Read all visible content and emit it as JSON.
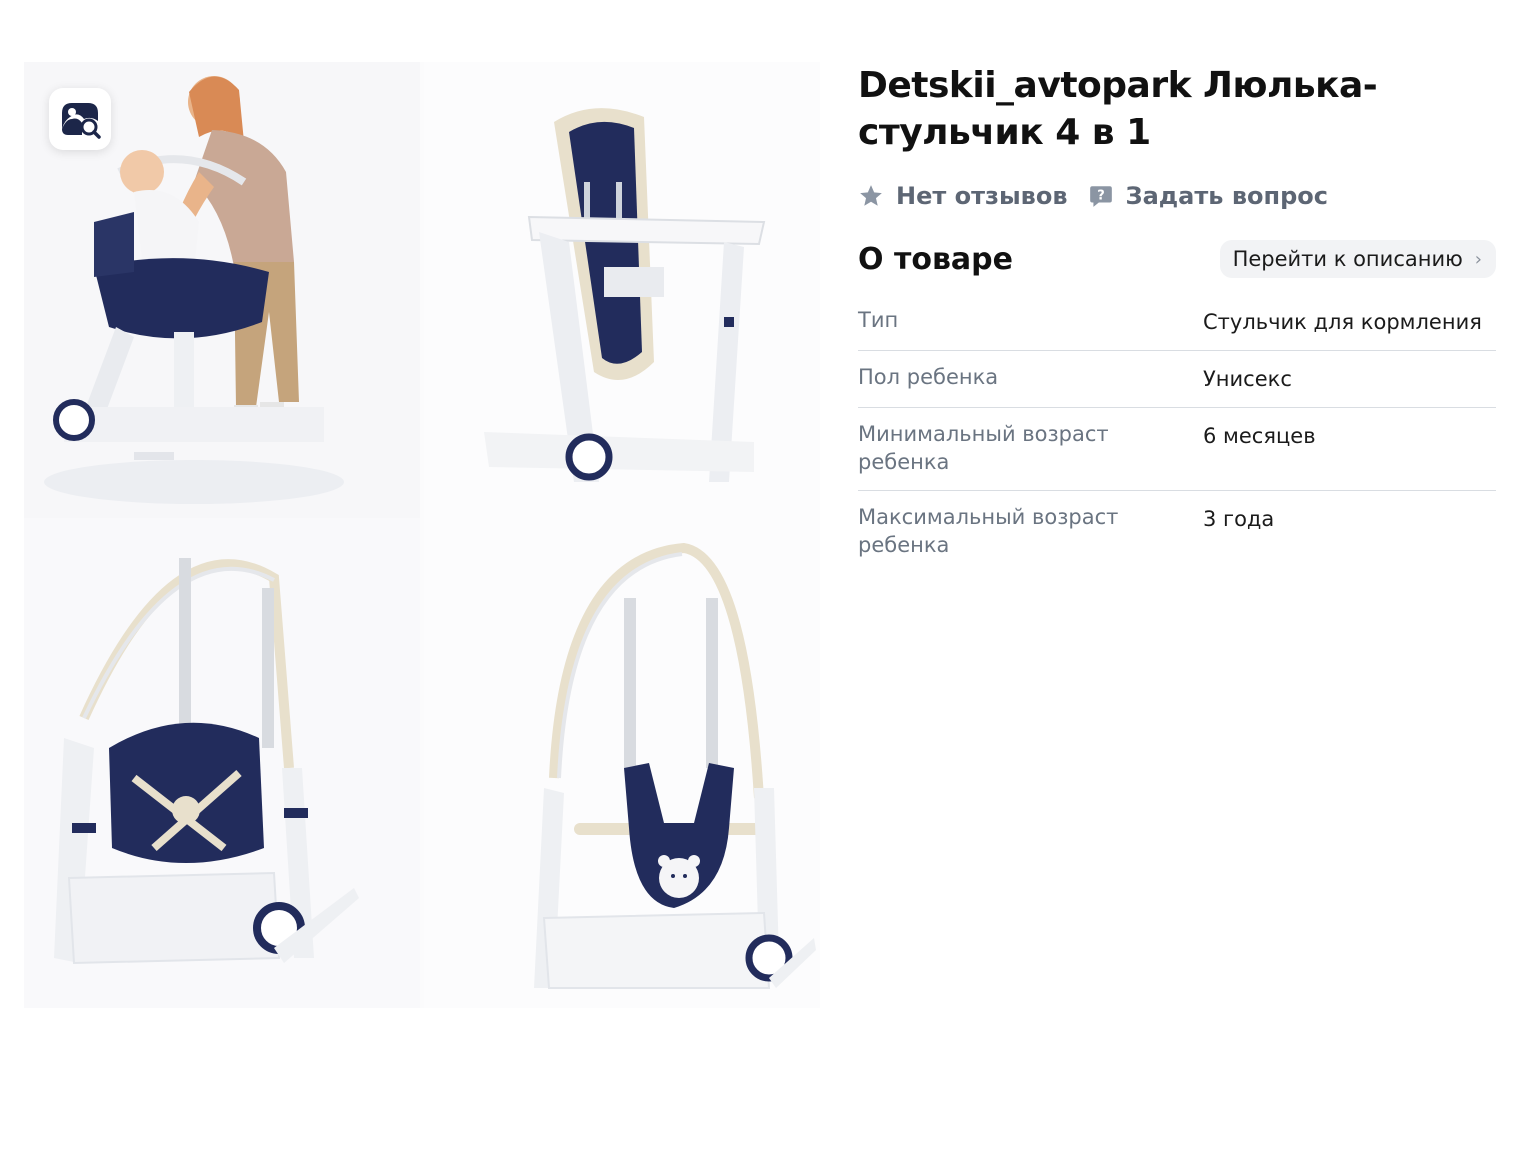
{
  "gallery": {
    "visual_search_label": "Поиск по фото",
    "colors": {
      "navy": "#222c5c",
      "frame": "#e9ebef",
      "beige": "#e8e0cc"
    }
  },
  "product": {
    "title": "Detskii_avtopark Люлька-стульчик 4 в 1",
    "reviews_label": "Нет отзывов",
    "question_label": "Задать вопрос"
  },
  "about": {
    "title": "О товаре",
    "goto_label": "Перейти к описанию",
    "properties": [
      {
        "name": "Тип",
        "value": "Стульчик для кормления"
      },
      {
        "name": "Пол ребенка",
        "value": "Унисекс"
      },
      {
        "name": "Минимальный возраст ребенка",
        "value": "6 месяцев"
      },
      {
        "name": "Максимальный возраст ребенка",
        "value": "3 года"
      }
    ]
  }
}
